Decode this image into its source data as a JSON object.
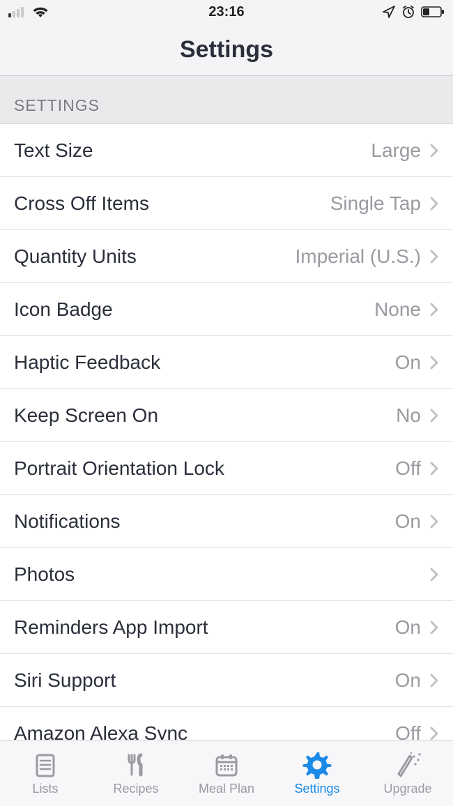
{
  "status": {
    "time": "23:16"
  },
  "header": {
    "title": "Settings"
  },
  "section": {
    "title": "SETTINGS"
  },
  "rows": {
    "text_size": {
      "label": "Text Size",
      "value": "Large"
    },
    "cross_off": {
      "label": "Cross Off Items",
      "value": "Single Tap"
    },
    "units": {
      "label": "Quantity Units",
      "value": "Imperial (U.S.)"
    },
    "icon_badge": {
      "label": "Icon Badge",
      "value": "None"
    },
    "haptic": {
      "label": "Haptic Feedback",
      "value": "On"
    },
    "screen_on": {
      "label": "Keep Screen On",
      "value": "No"
    },
    "portrait": {
      "label": "Portrait Orientation Lock",
      "value": "Off"
    },
    "notif": {
      "label": "Notifications",
      "value": "On"
    },
    "photos": {
      "label": "Photos",
      "value": ""
    },
    "reminders": {
      "label": "Reminders App Import",
      "value": "On"
    },
    "siri": {
      "label": "Siri Support",
      "value": "On"
    },
    "alexa": {
      "label": "Amazon Alexa Sync",
      "value": "Off"
    }
  },
  "tabs": {
    "lists": {
      "label": "Lists"
    },
    "recipes": {
      "label": "Recipes"
    },
    "mealplan": {
      "label": "Meal Plan"
    },
    "settings": {
      "label": "Settings"
    },
    "upgrade": {
      "label": "Upgrade"
    }
  }
}
